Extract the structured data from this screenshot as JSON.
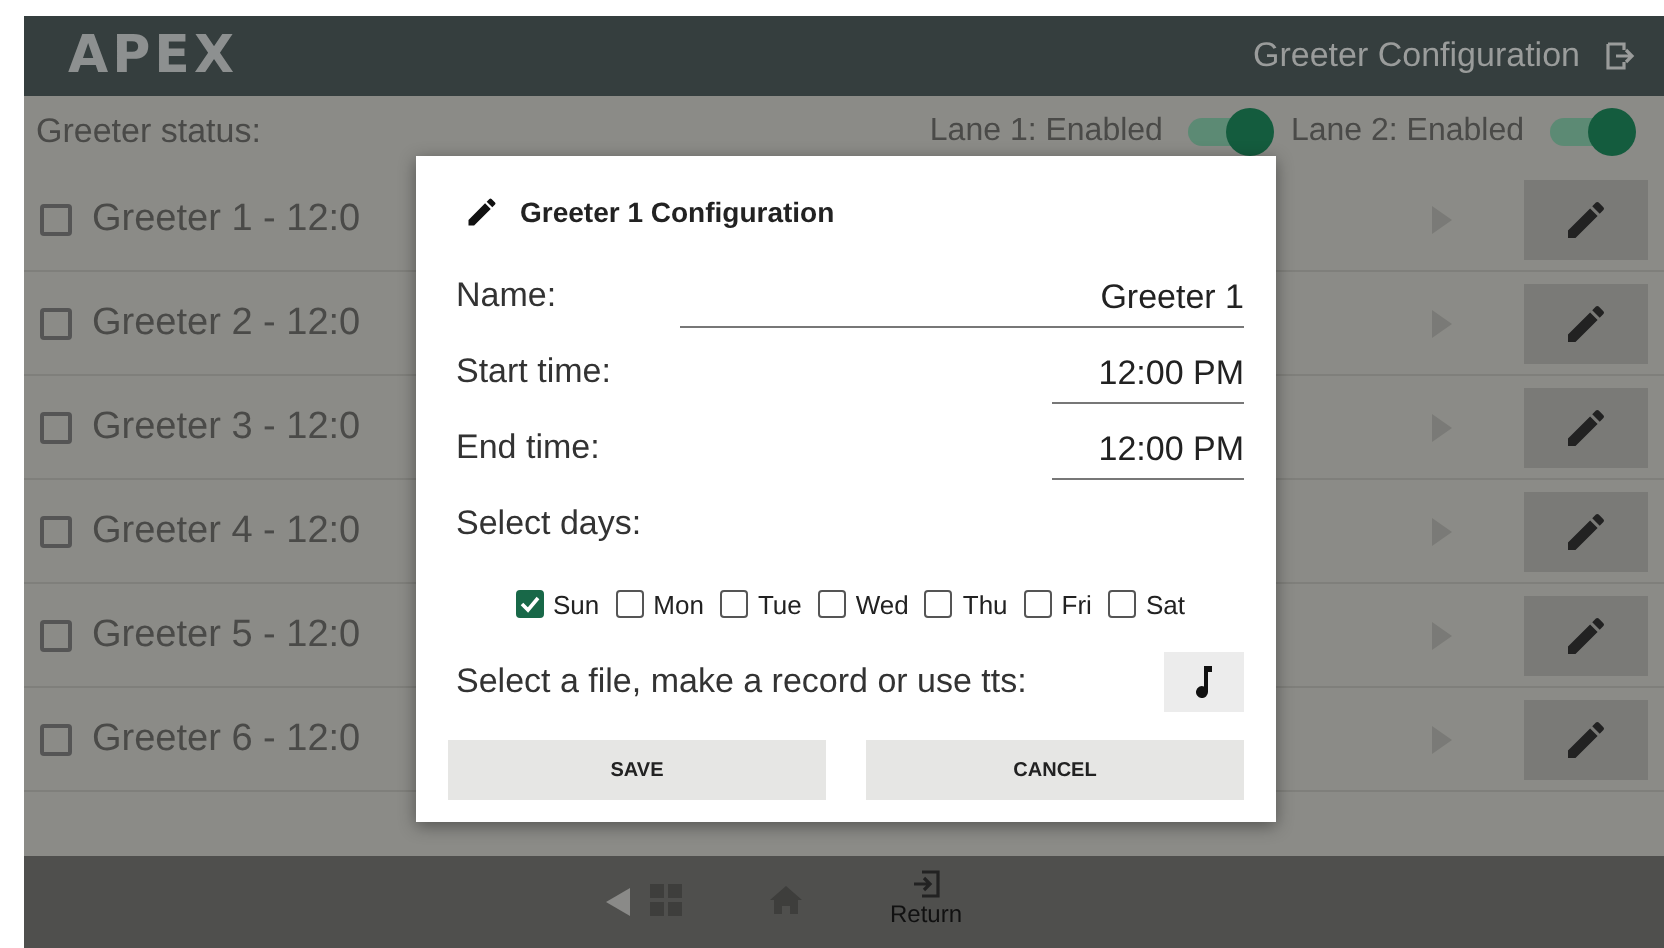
{
  "header": {
    "logo": "APEX",
    "title": "Greeter Configuration"
  },
  "status": {
    "label": "Greeter status:",
    "lanes": [
      {
        "label": "Lane 1: Enabled",
        "on": true
      },
      {
        "label": "Lane 2: Enabled",
        "on": true
      }
    ]
  },
  "greeters": [
    {
      "label": "Greeter 1 - 12:0",
      "checked": false
    },
    {
      "label": "Greeter 2 - 12:0",
      "checked": false
    },
    {
      "label": "Greeter 3 - 12:0",
      "checked": false
    },
    {
      "label": "Greeter 4 - 12:0",
      "checked": false
    },
    {
      "label": "Greeter 5 - 12:0",
      "checked": false
    },
    {
      "label": "Greeter 6 - 12:0",
      "checked": false
    }
  ],
  "dialog": {
    "title": "Greeter 1 Configuration",
    "fields": [
      {
        "label": "Name:",
        "value": "Greeter 1",
        "kind": "wide"
      },
      {
        "label": "Start time:",
        "value": "12:00 PM",
        "kind": "short"
      },
      {
        "label": "End time:",
        "value": "12:00 PM",
        "kind": "short"
      }
    ],
    "days_label": "Select days:",
    "days": [
      {
        "label": "Sun",
        "checked": true
      },
      {
        "label": "Mon",
        "checked": false
      },
      {
        "label": "Tue",
        "checked": false
      },
      {
        "label": "Wed",
        "checked": false
      },
      {
        "label": "Thu",
        "checked": false
      },
      {
        "label": "Fri",
        "checked": false
      },
      {
        "label": "Sat",
        "checked": false
      }
    ],
    "audio_label": "Select a file, make a record or use tts:",
    "buttons": [
      "SAVE",
      "CANCEL"
    ]
  },
  "nav": {
    "return_label": "Return"
  }
}
